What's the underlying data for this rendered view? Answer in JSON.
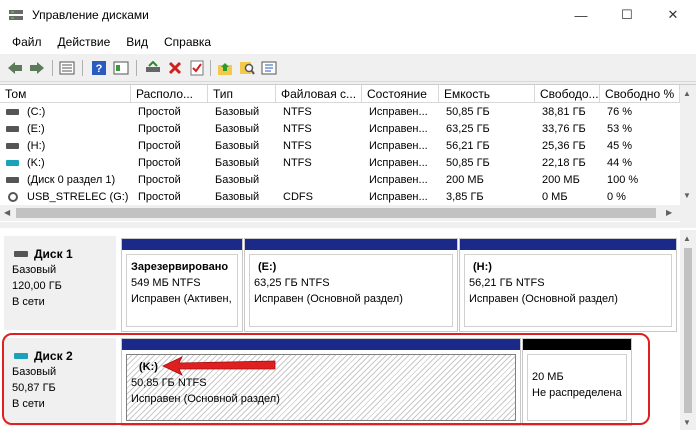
{
  "window": {
    "title": "Управление дисками",
    "min_glyph": "—",
    "max_glyph": "☐",
    "close_glyph": "✕"
  },
  "menu": [
    {
      "label": "Файл"
    },
    {
      "label": "Действие"
    },
    {
      "label": "Вид"
    },
    {
      "label": "Справка"
    }
  ],
  "toolbar": {
    "icons": [
      "back-arrow-icon",
      "forward-arrow-icon",
      "list-view-icon",
      "help-icon",
      "properties-icon",
      "connect-icon",
      "delete-icon",
      "checklist-icon",
      "folder-up-icon",
      "search-disk-icon",
      "details-icon"
    ]
  },
  "volume_table": {
    "headers": [
      "Том",
      "Располо...",
      "Тип",
      "Файловая с...",
      "Состояние",
      "Емкость",
      "Свободо...",
      "Свободно %"
    ],
    "rows": [
      {
        "name": "(C:)",
        "layout": "Простой",
        "type": "Базовый",
        "fs": "NTFS",
        "status": "Исправен...",
        "capacity": "50,85 ГБ",
        "free": "38,81 ГБ",
        "free_pct": "76 %",
        "icon": "hdd"
      },
      {
        "name": "(E:)",
        "layout": "Простой",
        "type": "Базовый",
        "fs": "NTFS",
        "status": "Исправен...",
        "capacity": "63,25 ГБ",
        "free": "33,76 ГБ",
        "free_pct": "53 %",
        "icon": "hdd"
      },
      {
        "name": "(H:)",
        "layout": "Простой",
        "type": "Базовый",
        "fs": "NTFS",
        "status": "Исправен...",
        "capacity": "56,21 ГБ",
        "free": "25,36 ГБ",
        "free_pct": "45 %",
        "icon": "hdd"
      },
      {
        "name": "(K:)",
        "layout": "Простой",
        "type": "Базовый",
        "fs": "NTFS",
        "status": "Исправен...",
        "capacity": "50,85 ГБ",
        "free": "22,18 ГБ",
        "free_pct": "44 %",
        "icon": "hdd-cyan"
      },
      {
        "name": "(Диск 0 раздел 1)",
        "layout": "Простой",
        "type": "Базовый",
        "fs": "",
        "status": "Исправен...",
        "capacity": "200 МБ",
        "free": "200 МБ",
        "free_pct": "100 %",
        "icon": "hdd"
      },
      {
        "name": "USB_STRELEC (G:)",
        "layout": "Простой",
        "type": "Базовый",
        "fs": "CDFS",
        "status": "Исправен...",
        "capacity": "3,85 ГБ",
        "free": "0 МБ",
        "free_pct": "0 %",
        "icon": "disc"
      }
    ]
  },
  "disks": [
    {
      "name": "Диск 1",
      "type": "Базовый",
      "size": "120,00 ГБ",
      "state": "В сети",
      "partitions": [
        {
          "name": "Зарезервировано",
          "size_fs": "549 МБ NTFS",
          "status": "Исправен (Активен,"
        },
        {
          "name": "(E:)",
          "size_fs": "63,25 ГБ NTFS",
          "status": "Исправен (Основной раздел)"
        },
        {
          "name": "(H:)",
          "size_fs": "56,21 ГБ NTFS",
          "status": "Исправен (Основной раздел)"
        }
      ]
    },
    {
      "name": "Диск 2",
      "type": "Базовый",
      "size": "50,87 ГБ",
      "state": "В сети",
      "partitions": [
        {
          "name": "(K:)",
          "size_fs": "50,85 ГБ NTFS",
          "status": "Исправен (Основной раздел)"
        },
        {
          "name": "",
          "size_fs": "20 МБ",
          "status": "Не распределена"
        }
      ]
    }
  ],
  "colors": {
    "primary_bar": "#1b2a88",
    "unallocated_bar": "#000000",
    "highlight": "#e02020",
    "arrow": "#e02020"
  }
}
